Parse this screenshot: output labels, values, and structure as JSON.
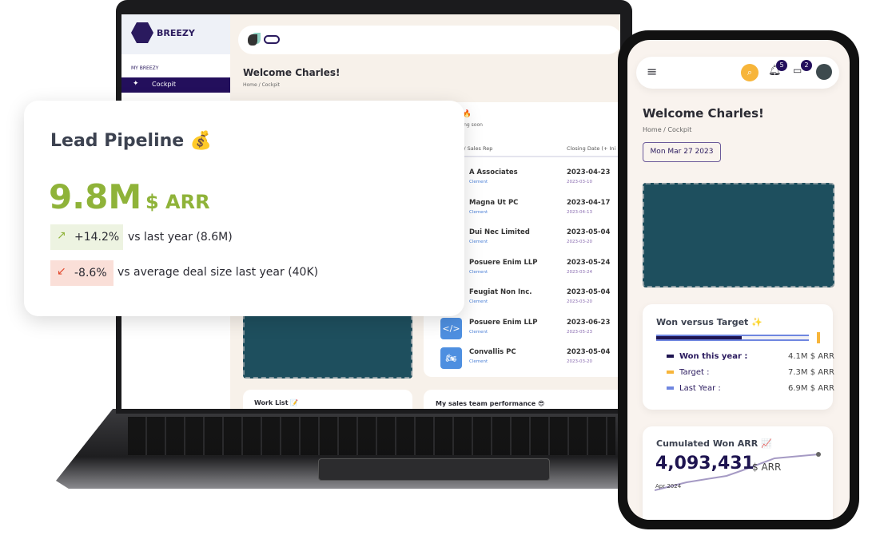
{
  "laptop": {
    "logo": "BREEZY",
    "sidebar": {
      "section": "MY BREEZY",
      "items": [
        {
          "label": "Cockpit",
          "icon": "sparkle-icon",
          "active": true
        }
      ]
    },
    "welcome": "Welcome Charles!",
    "breadcrumb": [
      "Home",
      "Cockpit"
    ],
    "deals": {
      "title_partial": "s 🔥",
      "subtitle_partial": "losing soon",
      "columns": [
        "nity / Sales Rep",
        "Closing Date (+ Ini"
      ],
      "rows": [
        {
          "name": "A Associates",
          "rep": "Clement",
          "closing": "2023-04-23",
          "initial": "2023-03-10"
        },
        {
          "name": "Magna Ut PC",
          "rep": "Clement",
          "closing": "2023-04-17",
          "initial": "2023-04-13"
        },
        {
          "name": "Dui Nec Limited",
          "rep": "Clement",
          "closing": "2023-05-04",
          "initial": "2023-03-20"
        },
        {
          "name": "Posuere Enim LLP",
          "rep": "Clement",
          "closing": "2023-05-24",
          "initial": "2023-03-24"
        },
        {
          "name": "Feugiat Non Inc.",
          "rep": "Clement",
          "closing": "2023-05-04",
          "initial": "2023-03-20"
        },
        {
          "name": "Posuere Enim LLP",
          "rep": "Clement",
          "closing": "2023-06-23",
          "initial": "2023-05-23",
          "icon": "code-icon"
        },
        {
          "name": "Convallis PC",
          "rep": "Clement",
          "closing": "2023-05-04",
          "initial": "2023-03-20",
          "icon": "motorbike-icon"
        }
      ]
    },
    "work_list": "Work List 📝",
    "sales_team": "My sales team performance 😎"
  },
  "pipeline": {
    "title": "Lead Pipeline 💰",
    "value": "9.8M",
    "unit": "$ ARR",
    "value_color": "#8fb339",
    "stats": [
      {
        "change": "+14.2%",
        "text": "vs last year (8.6M)",
        "direction": "up",
        "color": "#8fb339"
      },
      {
        "change": "-8.6%",
        "text": "vs average deal size last year (40K)",
        "direction": "down",
        "color": "#e24a2e"
      }
    ]
  },
  "phone": {
    "notifications": "5",
    "messages": "2",
    "welcome": "Welcome Charles!",
    "breadcrumb": [
      "Home",
      "Cockpit"
    ],
    "date": "Mon Mar 27 2023",
    "won_vs_target": {
      "title": "Won versus Target ✨",
      "won_fraction": 0.56,
      "legend": [
        {
          "label": "Won this year :",
          "value": "4.1M $ ARR",
          "color": "#1e1450"
        },
        {
          "label": "Target :",
          "value": "7.3M $ ARR",
          "color": "#f7b53a"
        },
        {
          "label": "Last Year :",
          "value": "6.9M $ ARR",
          "color": "#6f86e0"
        }
      ]
    },
    "cumulated": {
      "title": "Cumulated Won ARR 📈",
      "value": "4,093,431",
      "unit": "$ ARR",
      "date": "Apr 2024"
    }
  }
}
